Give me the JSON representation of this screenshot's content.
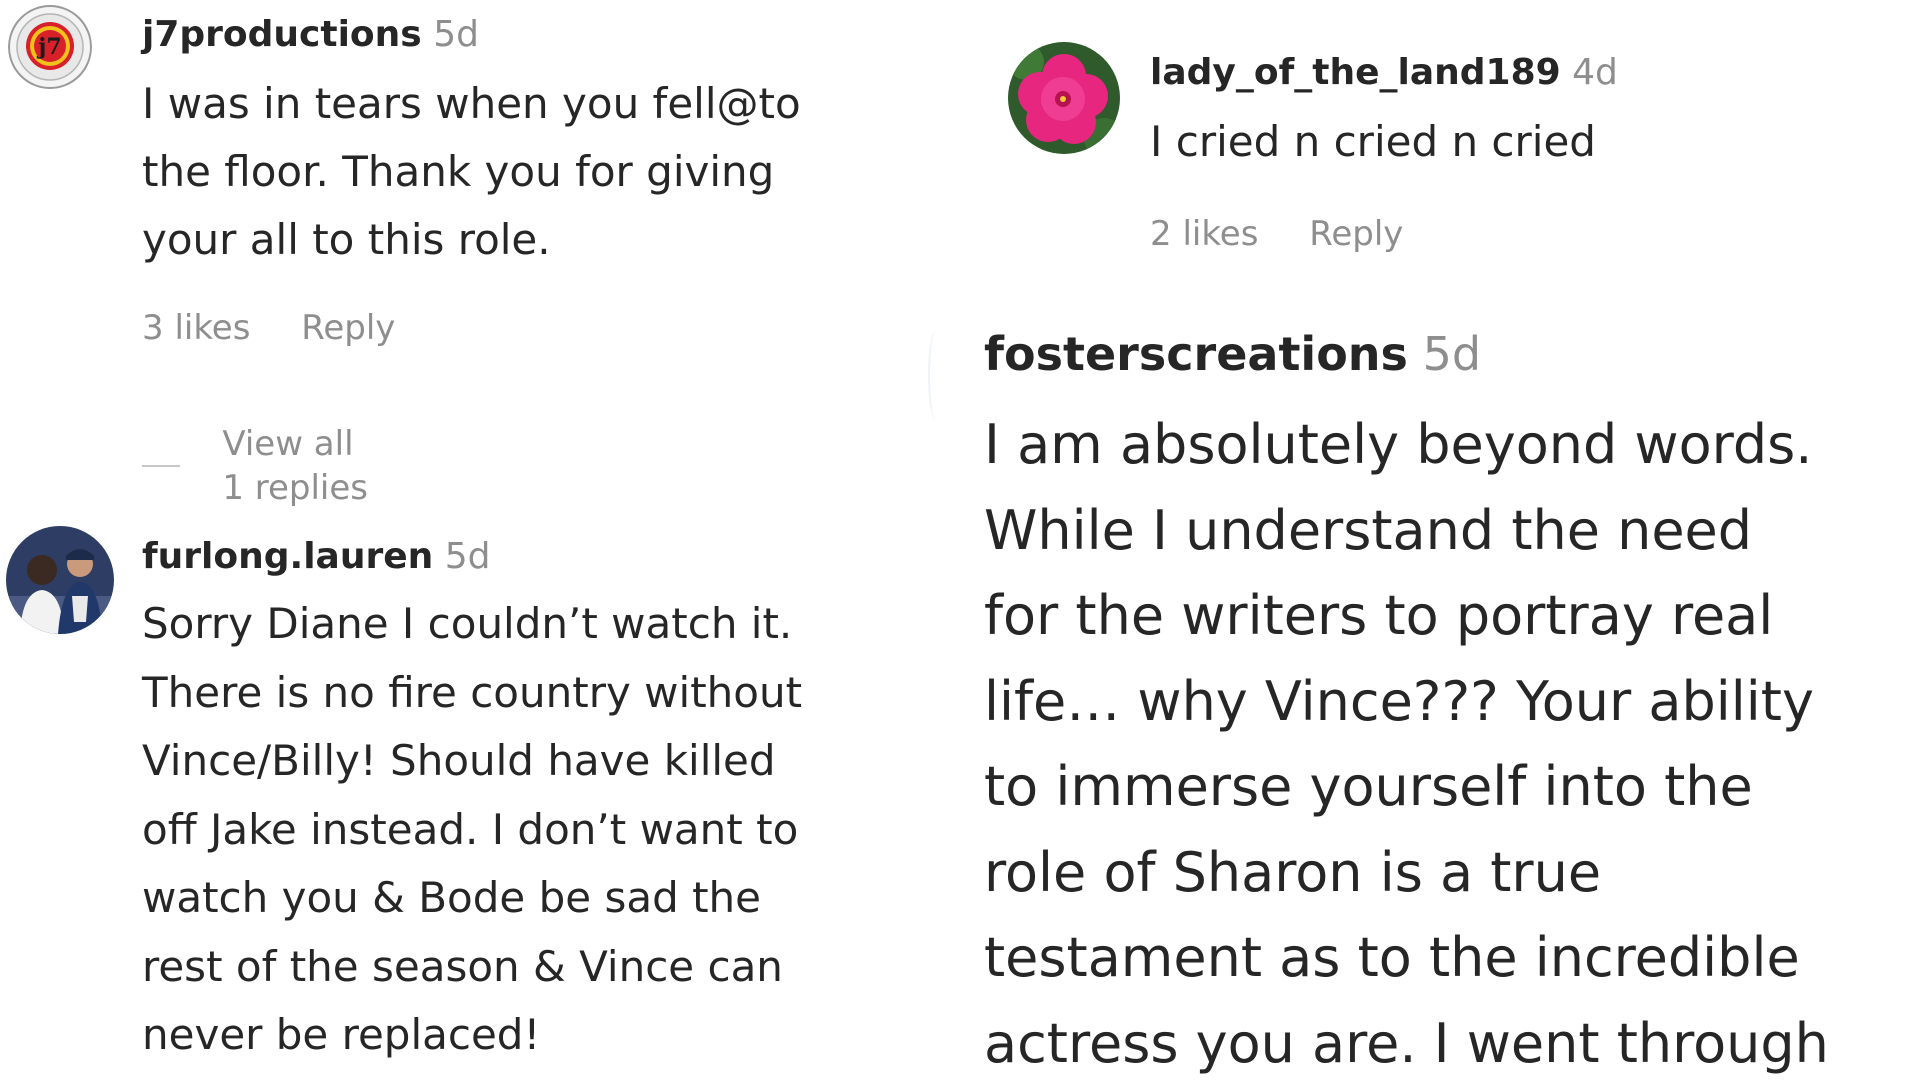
{
  "comments": [
    {
      "username": "j7productions",
      "age": "5d",
      "lines": [
        "I was in tears when you fell@to",
        "the floor. Thank you for giving",
        "your all to this role."
      ],
      "likes": "3 likes",
      "reply": "Reply",
      "view_replies": "View all 1 replies"
    },
    {
      "username": "furlong.lauren",
      "age": "5d",
      "lines": [
        "Sorry Diane I couldn’t watch it.",
        "There is no fire country without",
        "Vince/Billy! Should have killed",
        "off Jake instead. I don’t want to",
        "watch you & Bode be sad the",
        "rest of the season & Vince can",
        "never be replaced!"
      ]
    },
    {
      "username": "lady_of_the_land189",
      "age": "4d",
      "lines": [
        "I cried n cried n cried"
      ],
      "likes": "2 likes",
      "reply": "Reply"
    },
    {
      "username": "fosterscreations",
      "age": "5d",
      "lines": [
        "I am absolutely beyond words.",
        "While I understand the need",
        "for the writers to portray real",
        "life… why Vince??? Your ability",
        "to immerse yourself into the",
        "role of Sharon is a true",
        "testament as to the incredible",
        "actress you are. I went through"
      ]
    }
  ],
  "colors": {
    "text": "#262626",
    "secondary": "#8e8e8e",
    "background": "#ffffff"
  }
}
